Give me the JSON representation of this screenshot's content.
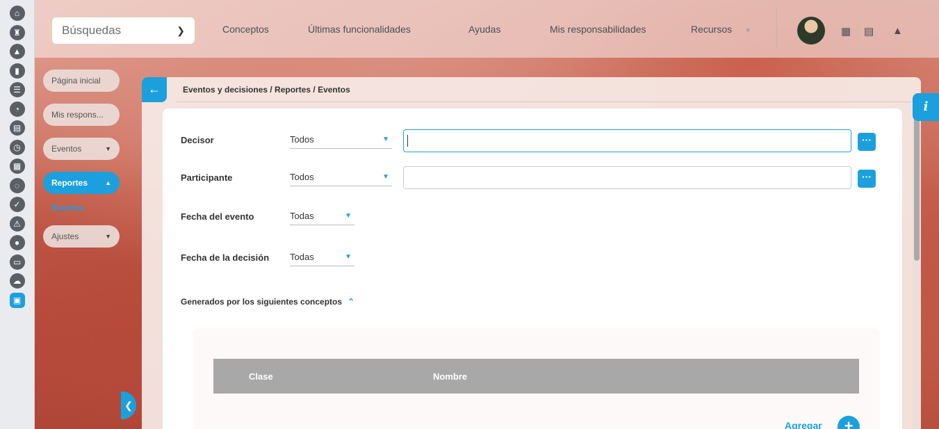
{
  "rail": {
    "icons": [
      {
        "name": "home-icon",
        "glyph": "⌂"
      },
      {
        "name": "tower-icon",
        "glyph": "♜"
      },
      {
        "name": "user-icon",
        "glyph": "▲"
      },
      {
        "name": "bar-chart-icon",
        "glyph": "▮"
      },
      {
        "name": "list-icon",
        "glyph": "☰"
      },
      {
        "name": "pie-chart-icon",
        "glyph": "◔"
      },
      {
        "name": "book-icon",
        "glyph": "▤"
      },
      {
        "name": "clock-icon",
        "glyph": "◷"
      },
      {
        "name": "document-icon",
        "glyph": "▦"
      },
      {
        "name": "cycle-icon",
        "glyph": "◌"
      },
      {
        "name": "check-icon",
        "glyph": "✓"
      },
      {
        "name": "warning-icon",
        "glyph": "⚠"
      },
      {
        "name": "comments-icon",
        "glyph": "●"
      },
      {
        "name": "presentation-icon",
        "glyph": "▭"
      },
      {
        "name": "cloud-icon",
        "glyph": "☁"
      },
      {
        "name": "calendar-icon",
        "glyph": "▣"
      }
    ]
  },
  "header": {
    "search_label": "Búsquedas",
    "nav": {
      "conceptos": "Conceptos",
      "ultimas": "Últimas funcionalidades",
      "ayudas": "Ayudas",
      "responsabilidades": "Mis responsabilidades",
      "recursos": "Recursos"
    }
  },
  "menu": {
    "pagina_inicial": "Página inicial",
    "mis_respons": "Mis respons...",
    "eventos": "Eventos",
    "reportes": "Reportes",
    "sub_eventos": "Eventos",
    "ajustes": "Ajustes"
  },
  "panel": {
    "breadcrumb": "Eventos y decisiones / Reportes / Eventos"
  },
  "form": {
    "decisor_label": "Decisor",
    "decisor_value": "Todos",
    "participante_label": "Participante",
    "participante_value": "Todos",
    "fecha_evento_label": "Fecha del evento",
    "fecha_evento_value": "Todas",
    "fecha_decision_label": "Fecha de la decisión",
    "fecha_decision_value": "Todas",
    "concepts_title": "Generados por los siguientes conceptos",
    "dots": "···"
  },
  "table": {
    "col_clase": "Clase",
    "col_nombre": "Nombre"
  },
  "actions": {
    "agregar": "Agregar"
  },
  "colors": {
    "accent": "#1ca0dd",
    "table_header": "#a8a8a8"
  }
}
